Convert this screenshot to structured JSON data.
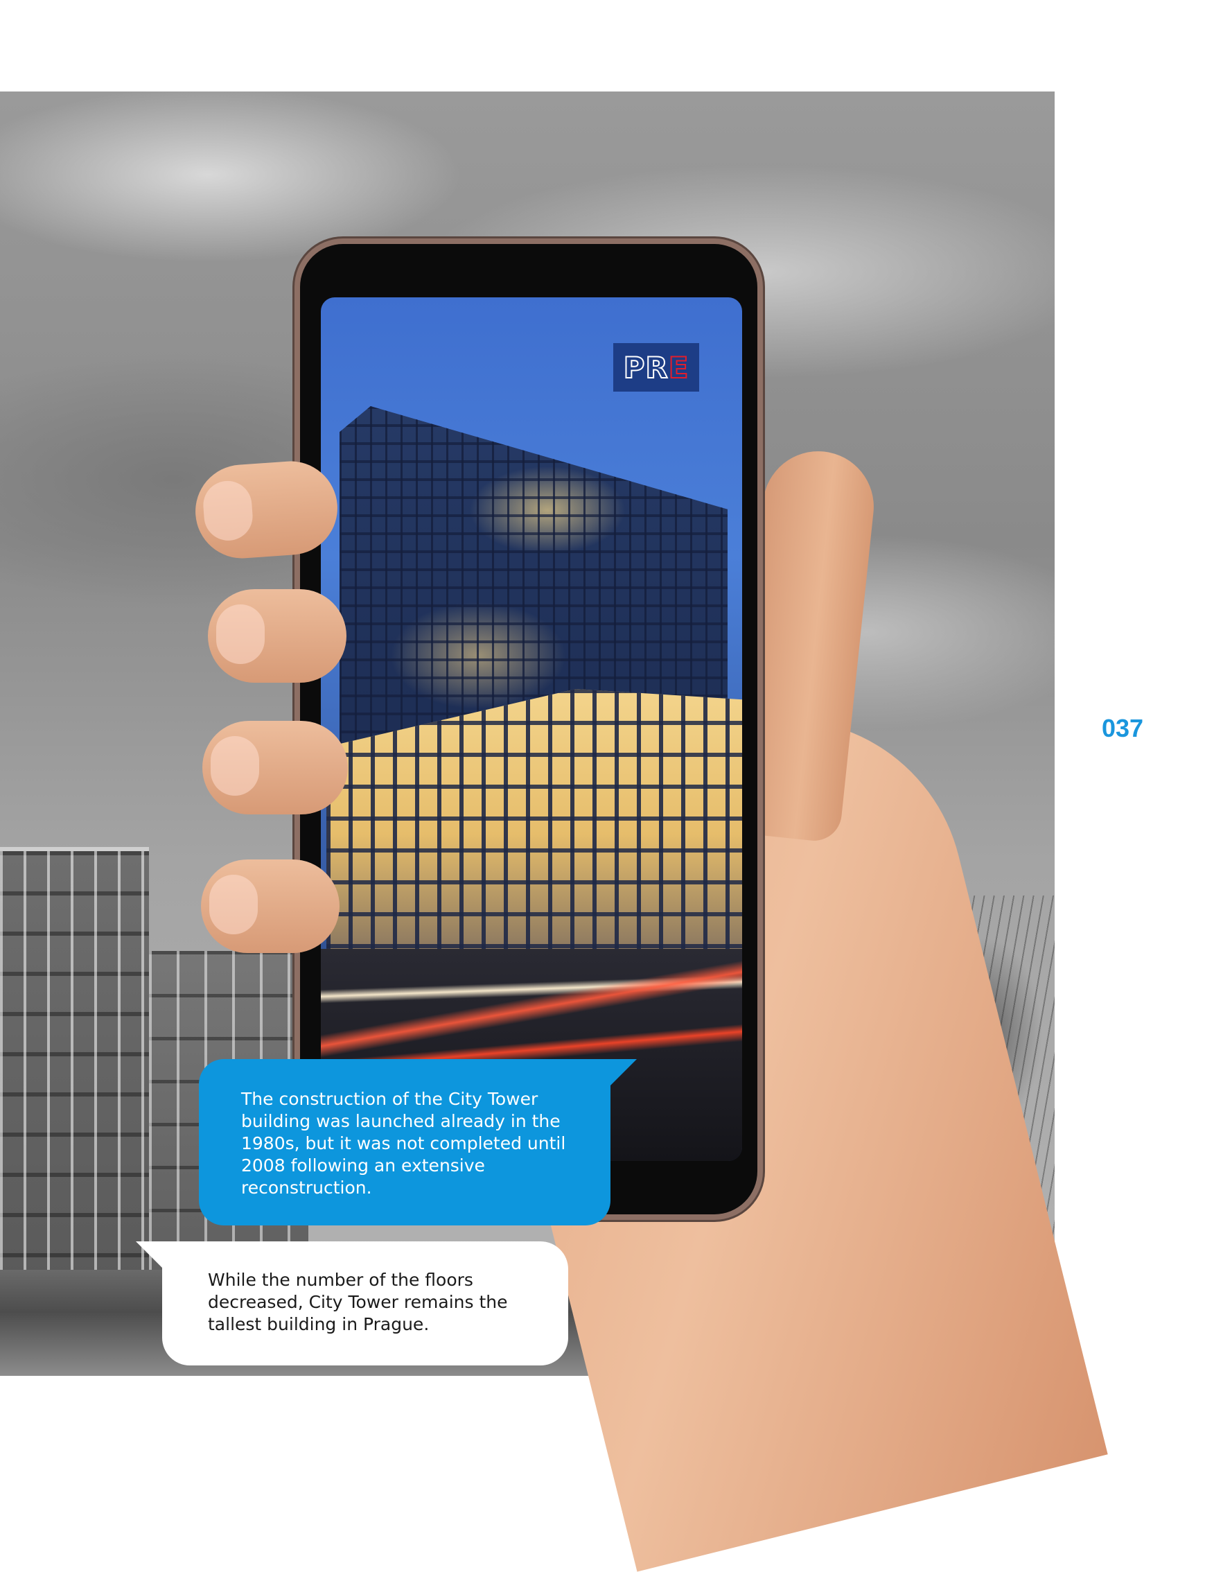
{
  "page": {
    "number": "037",
    "accent_color": "#1a96dd"
  },
  "background": {
    "photo": "grayscale-office-buildings-under-cloudy-sky"
  },
  "phone": {
    "screen_photo": "city-tower-at-dusk",
    "logo": {
      "text_pr": "PR",
      "text_e": "E",
      "bg_color": "#1d3d86",
      "pr_color": "#ffffff",
      "e_color": "#e31d2b"
    }
  },
  "captions": {
    "construction": "The construction of the City Tower building was launched already in the 1980s, but it was not completed until 2008 following an extensive reconstruction.",
    "tallest": "While the number of the floors decreased, City Tower remains the tallest building in Prague."
  }
}
